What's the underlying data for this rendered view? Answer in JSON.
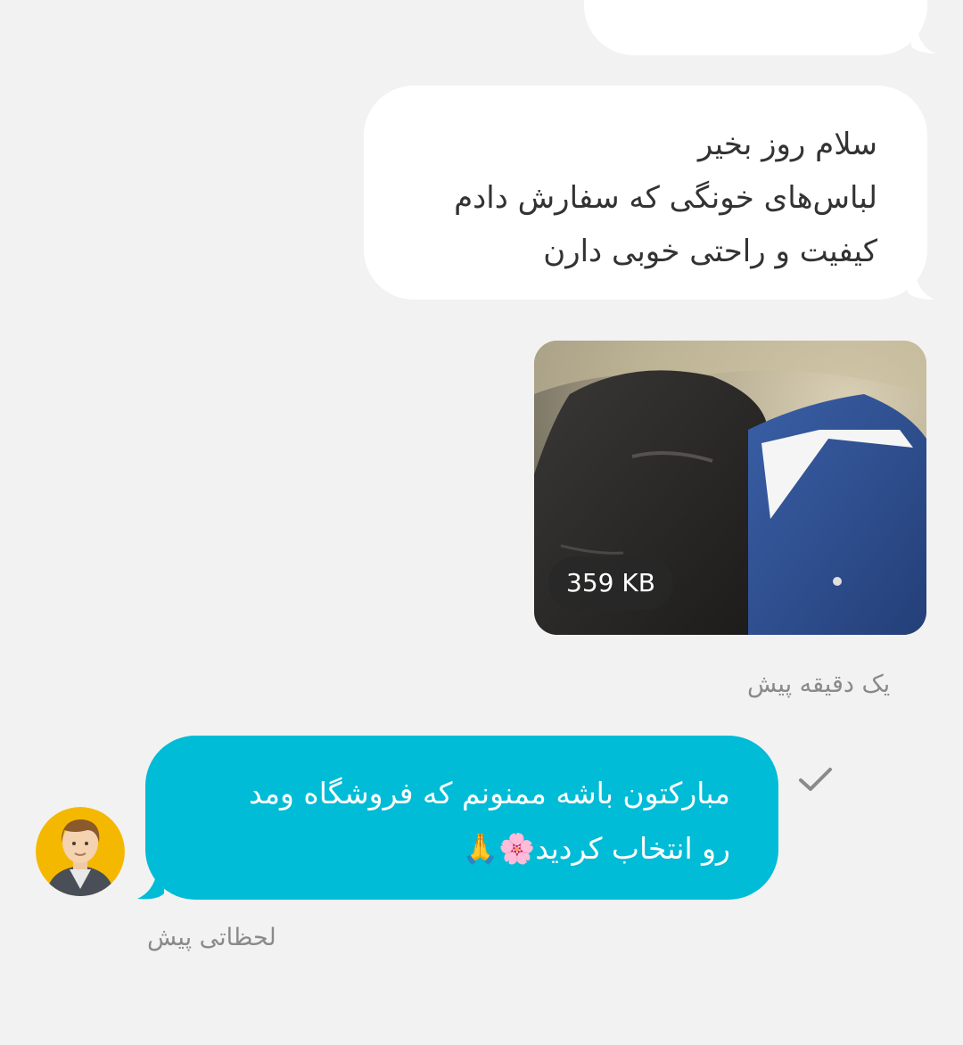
{
  "messages": {
    "incoming_text_lines": [
      "سلام روز بخیر",
      "لباس‌های خونگی که سفارش دادم",
      "کیفیت و راحتی خوبی دارن"
    ],
    "incoming_photo": {
      "file_size": "359 KB"
    },
    "incoming_timestamp": "یک دقیقه پیش",
    "outgoing_text_lines": [
      "مبارکتون باشه ممنونم که فروشگاه ومد",
      "رو انتخاب کردید🌸🙏"
    ],
    "outgoing_timestamp": "لحظاتی پیش",
    "outgoing_status_icon": "check-icon"
  },
  "colors": {
    "background": "#f2f2f2",
    "incoming_bubble": "#ffffff",
    "outgoing_bubble": "#00bcd6",
    "avatar_bg": "#f5b800"
  }
}
